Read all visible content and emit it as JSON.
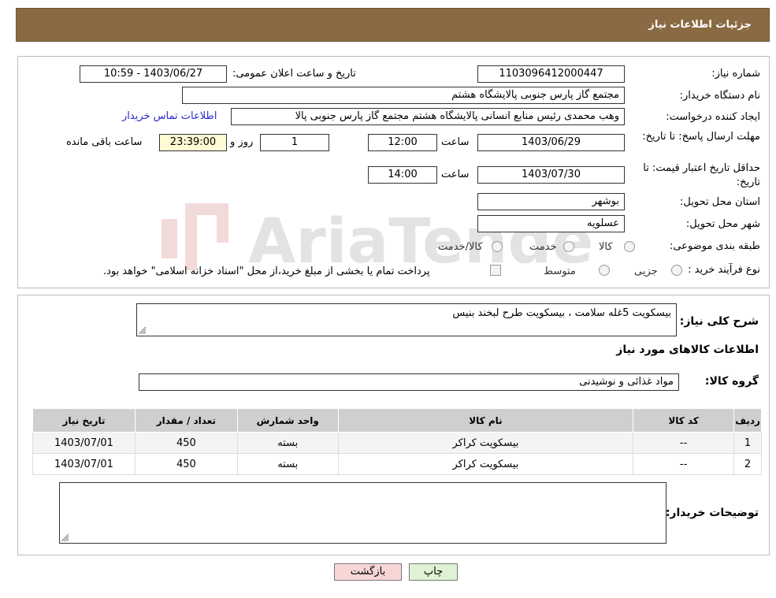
{
  "header": {
    "title": "جزئیات اطلاعات نیاز"
  },
  "fields": {
    "need_number_label": "شماره نیاز:",
    "need_number": "1103096412000447",
    "announce_label": "تاریخ و ساعت اعلان عمومی:",
    "announce_value": "1403/06/27 - 10:59",
    "buyer_org_label": "نام دستگاه خریدار:",
    "buyer_org": "مجتمع گاز پارس جنوبی  پالایشگاه هشتم",
    "creator_label": "ایجاد کننده درخواست:",
    "creator": "وهب محمدی رئیس منابع انسانی پالایشگاه هشتم مجتمع گاز پارس جنوبی  پالا",
    "contact_link": "اطلاعات تماس خریدار",
    "deadline_label": "مهلت ارسال پاسخ: تا تاریخ:",
    "deadline_date": "1403/06/29",
    "time_label": "ساعت",
    "deadline_time": "12:00",
    "days": "1",
    "days_label": "روز و",
    "remaining": "23:39:00",
    "remaining_label": "ساعت باقی مانده",
    "validity_label": "حداقل تاریخ اعتبار قیمت: تا تاریخ:",
    "validity_date": "1403/07/30",
    "validity_time": "14:00",
    "province_label": "استان محل تحویل:",
    "province": "بوشهر",
    "city_label": "شهر محل تحویل:",
    "city": "عسلویه",
    "category_label": "طبقه بندی موضوعی:",
    "cat_goods": "کالا",
    "cat_service": "خدمت",
    "cat_goods_service": "کالا/خدمت",
    "process_label": "نوع فرآیند خرید :",
    "proc_small": "جزیی",
    "proc_medium": "متوسط",
    "payment_note": "پرداخت تمام یا بخشی از مبلغ خرید،از محل \"اسناد خزانه اسلامی\" خواهد بود."
  },
  "details": {
    "summary_label": "شرح کلی نیاز:",
    "summary": "بیسکویت 5غله سلامت ، بیسکویت طرح لبخند بنیس",
    "goods_info_title": "اطلاعات کالاهای مورد نیاز",
    "group_label": "گروه کالا:",
    "group_value": "مواد غذائی و نوشیدنی"
  },
  "table": {
    "headers": [
      "ردیف",
      "کد کالا",
      "نام کالا",
      "واحد شمارش",
      "تعداد / مقدار",
      "تاریخ نیاز"
    ],
    "rows": [
      [
        "1",
        "--",
        "بیسکویت کراکر",
        "بسته",
        "450",
        "1403/07/01"
      ],
      [
        "2",
        "--",
        "بیسکویت کراکر",
        "بسته",
        "450",
        "1403/07/01"
      ]
    ]
  },
  "buyer_notes_label": "توضیحات خریدار:",
  "buttons": {
    "back": "بازگشت",
    "print": "چاپ"
  },
  "watermark": "AriaTender.neT"
}
